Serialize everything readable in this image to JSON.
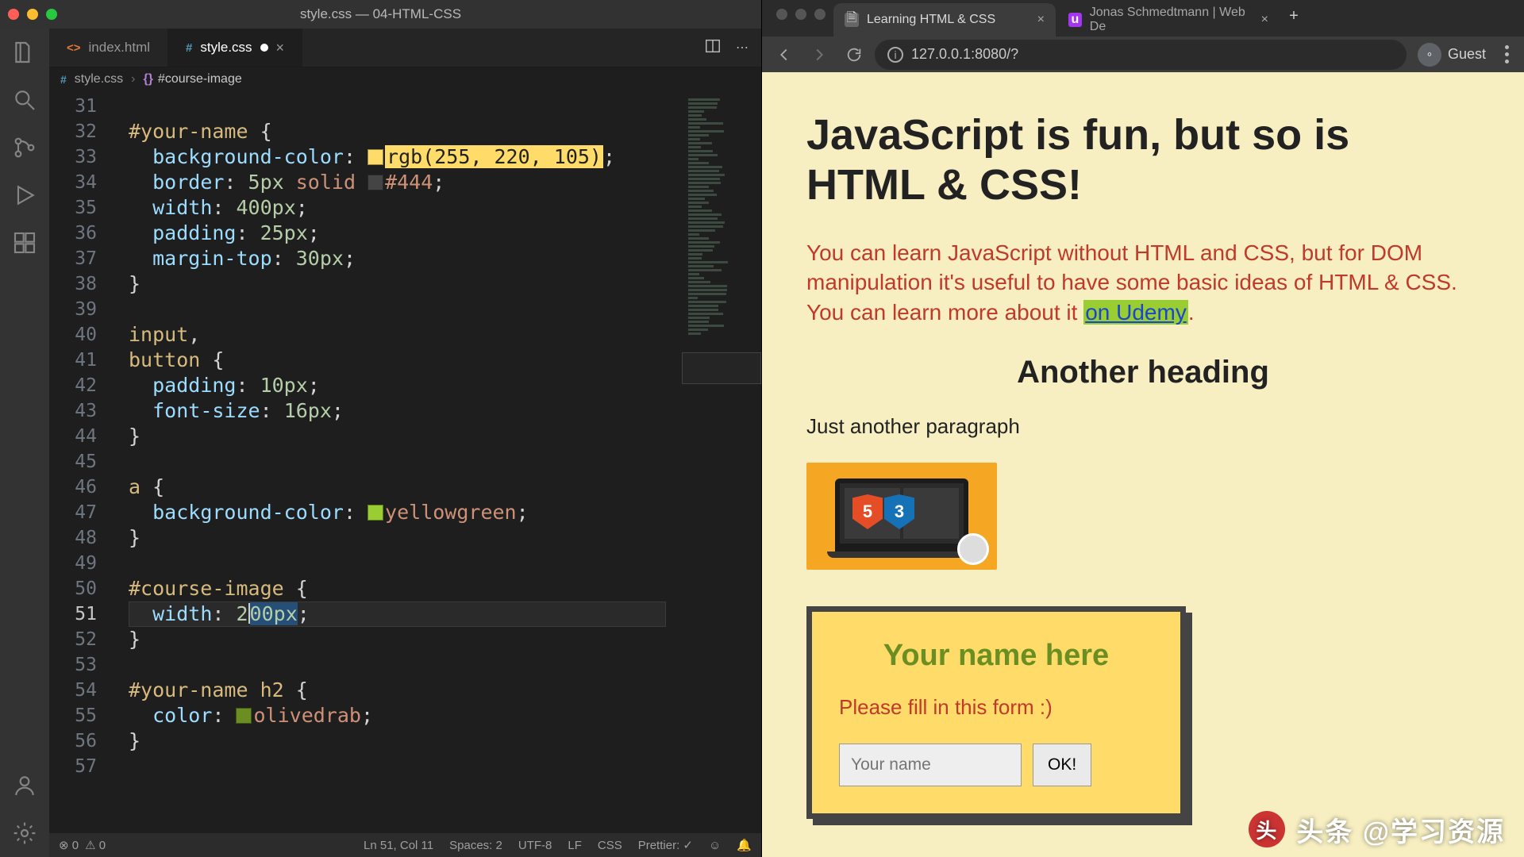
{
  "vscode": {
    "window_title": "style.css — 04-HTML-CSS",
    "tabs": [
      {
        "icon": "#",
        "icon_class": "html",
        "label": "index.html",
        "active": false,
        "close": true
      },
      {
        "icon": "#",
        "icon_class": "css",
        "label": "style.css",
        "active": true,
        "modified": true
      }
    ],
    "breadcrumbs": {
      "file": "style.css",
      "selector": "#course-image"
    },
    "first_line_number": 31,
    "current_line_number": 51,
    "code_tokens": [
      [],
      [
        [
          "t-sel",
          "#your-name"
        ],
        [
          "t-p",
          " {"
        ]
      ],
      [
        [
          "t-p",
          "  "
        ],
        [
          "t-prop",
          "background-color"
        ],
        [
          "t-p",
          ": "
        ],
        [
          "swatch",
          "#ffdc69"
        ],
        [
          "t-func",
          "rgb(255, 220, 105)"
        ],
        [
          "t-p",
          ";"
        ]
      ],
      [
        [
          "t-p",
          "  "
        ],
        [
          "t-prop",
          "border"
        ],
        [
          "t-p",
          ": "
        ],
        [
          "t-num",
          "5px"
        ],
        [
          "t-p",
          " "
        ],
        [
          "t-val",
          "solid"
        ],
        [
          "t-p",
          " "
        ],
        [
          "swatch",
          "#444444"
        ],
        [
          "t-val",
          "#444"
        ],
        [
          "t-p",
          ";"
        ]
      ],
      [
        [
          "t-p",
          "  "
        ],
        [
          "t-prop",
          "width"
        ],
        [
          "t-p",
          ": "
        ],
        [
          "t-num",
          "400px"
        ],
        [
          "t-p",
          ";"
        ]
      ],
      [
        [
          "t-p",
          "  "
        ],
        [
          "t-prop",
          "padding"
        ],
        [
          "t-p",
          ": "
        ],
        [
          "t-num",
          "25px"
        ],
        [
          "t-p",
          ";"
        ]
      ],
      [
        [
          "t-p",
          "  "
        ],
        [
          "t-prop",
          "margin-top"
        ],
        [
          "t-p",
          ": "
        ],
        [
          "t-num",
          "30px"
        ],
        [
          "t-p",
          ";"
        ]
      ],
      [
        [
          "t-p",
          "}"
        ]
      ],
      [],
      [
        [
          "t-sel",
          "input"
        ],
        [
          "t-p",
          ","
        ]
      ],
      [
        [
          "t-sel",
          "button"
        ],
        [
          "t-p",
          " {"
        ]
      ],
      [
        [
          "t-p",
          "  "
        ],
        [
          "t-prop",
          "padding"
        ],
        [
          "t-p",
          ": "
        ],
        [
          "t-num",
          "10px"
        ],
        [
          "t-p",
          ";"
        ]
      ],
      [
        [
          "t-p",
          "  "
        ],
        [
          "t-prop",
          "font-size"
        ],
        [
          "t-p",
          ": "
        ],
        [
          "t-num",
          "16px"
        ],
        [
          "t-p",
          ";"
        ]
      ],
      [
        [
          "t-p",
          "}"
        ]
      ],
      [],
      [
        [
          "t-sel",
          "a"
        ],
        [
          "t-p",
          " {"
        ]
      ],
      [
        [
          "t-p",
          "  "
        ],
        [
          "t-prop",
          "background-color"
        ],
        [
          "t-p",
          ": "
        ],
        [
          "swatch",
          "#9acd32"
        ],
        [
          "t-val",
          "yellowgreen"
        ],
        [
          "t-p",
          ";"
        ]
      ],
      [
        [
          "t-p",
          "}"
        ]
      ],
      [],
      [
        [
          "t-sel",
          "#course-image"
        ],
        [
          "t-p",
          " {"
        ]
      ],
      [
        [
          "t-p",
          "  "
        ],
        [
          "t-prop",
          "width"
        ],
        [
          "t-p",
          ": "
        ],
        [
          "t-num",
          "2"
        ],
        [
          "caret",
          ""
        ],
        [
          "sel-box t-num",
          "00px"
        ],
        [
          "t-p",
          ";"
        ]
      ],
      [
        [
          "t-p",
          "}"
        ]
      ],
      [],
      [
        [
          "t-sel",
          "#your-name"
        ],
        [
          "t-p",
          " "
        ],
        [
          "t-sel",
          "h2"
        ],
        [
          "t-p",
          " {"
        ]
      ],
      [
        [
          "t-p",
          "  "
        ],
        [
          "t-prop",
          "color"
        ],
        [
          "t-p",
          ": "
        ],
        [
          "swatch",
          "#6b8e23"
        ],
        [
          "t-val",
          "olivedrab"
        ],
        [
          "t-p",
          ";"
        ]
      ],
      [
        [
          "t-p",
          "}"
        ]
      ],
      []
    ],
    "statusbar": {
      "errors": "0",
      "warnings": "0",
      "ln_col": "Ln 51, Col 11",
      "spaces": "Spaces: 2",
      "encoding": "UTF-8",
      "eol": "LF",
      "lang": "CSS",
      "prettier": "Prettier: ✓"
    }
  },
  "chrome": {
    "tabs": [
      {
        "label": "Learning HTML & CSS",
        "active": true
      },
      {
        "label": "Jonas Schmedtmann | Web De",
        "active": false,
        "favicon_text": "u",
        "favicon_color": "#a435f0"
      }
    ],
    "url": "127.0.0.1:8080/?",
    "guest": "Guest"
  },
  "page": {
    "h1": "JavaScript is fun, but so is HTML & CSS!",
    "intro_pre": "You can learn JavaScript without HTML and CSS, but for DOM manipulation it's useful to have some basic ideas of HTML & CSS. You can learn more about it ",
    "intro_link": "on Udemy",
    "intro_post": ".",
    "h2": "Another heading",
    "para": "Just another paragraph",
    "form": {
      "title": "Your name here",
      "hint": "Please fill in this form :)",
      "placeholder": "Your name",
      "button": "OK!"
    }
  },
  "watermark": "头条 @学习资源"
}
